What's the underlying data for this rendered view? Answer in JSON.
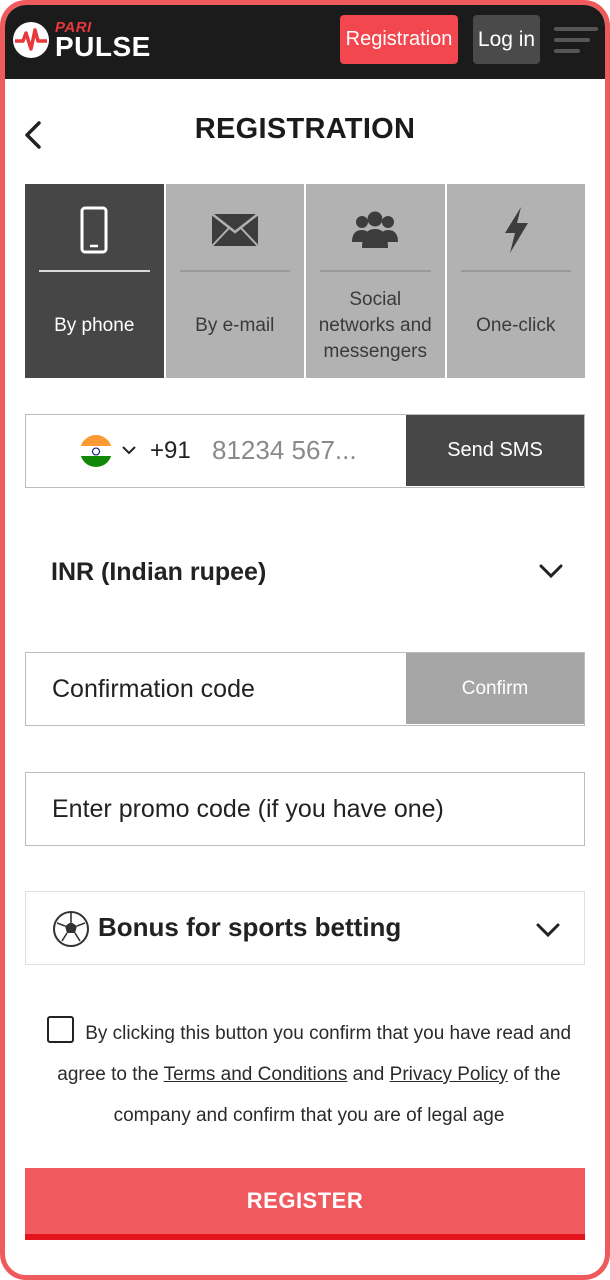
{
  "brand": {
    "logo_top": "PARI",
    "logo_bottom": "PULSE",
    "accent_color": "#f2474e"
  },
  "header": {
    "registration_label": "Registration",
    "login_label": "Log in",
    "menu_icon": "hamburger-menu-icon"
  },
  "page": {
    "title": "REGISTRATION",
    "back_icon": "chevron-left-icon"
  },
  "tabs": [
    {
      "label": "By phone",
      "icon": "smartphone-icon",
      "active": true
    },
    {
      "label": "By e-mail",
      "icon": "envelope-icon",
      "active": false
    },
    {
      "label": "Social networks and messengers",
      "icon": "users-group-icon",
      "active": false
    },
    {
      "label": "One-click",
      "icon": "lightning-icon",
      "active": false
    }
  ],
  "phone": {
    "country_flag": "india-flag-icon",
    "dial_code": "+91",
    "placeholder": "81234 567...",
    "send_sms_label": "Send SMS"
  },
  "currency": {
    "selected": "INR (Indian rupee)"
  },
  "confirmation": {
    "placeholder": "Confirmation code",
    "confirm_label": "Confirm"
  },
  "promo": {
    "placeholder": "Enter promo code (if you have one)"
  },
  "bonus": {
    "label": "Bonus for sports betting",
    "icon": "soccer-ball-icon"
  },
  "agreement": {
    "text_1": "By clicking this button you confirm that you have read and agree to the",
    "terms_link": "Terms and Conditions",
    "text_2": "and",
    "privacy_link": "Privacy Policy",
    "text_3": "of the company and confirm that you are of legal age",
    "checked": false
  },
  "register_label": "REGISTER"
}
